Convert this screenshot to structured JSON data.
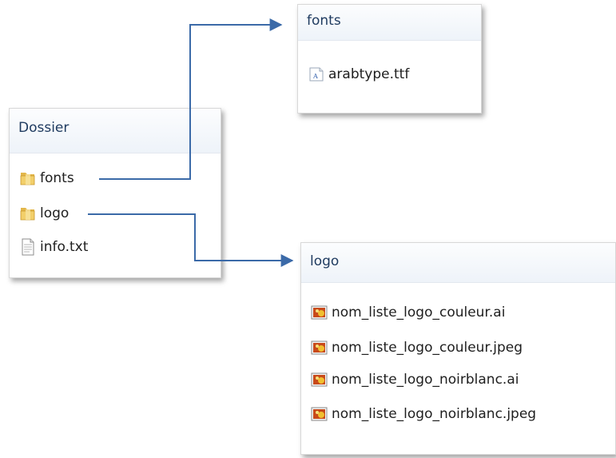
{
  "panels": {
    "dossier": {
      "title": "Dossier",
      "items": [
        {
          "label": "fonts",
          "icon": "folder-icon"
        },
        {
          "label": "logo",
          "icon": "folder-icon"
        },
        {
          "label": "info.txt",
          "icon": "text-file-icon"
        }
      ]
    },
    "fonts": {
      "title": "fonts",
      "items": [
        {
          "label": "arabtype.ttf",
          "icon": "font-file-icon"
        }
      ]
    },
    "logo": {
      "title": "logo",
      "items": [
        {
          "label": "nom_liste_logo_couleur.ai",
          "icon": "image-file-icon"
        },
        {
          "label": "nom_liste_logo_couleur.jpeg",
          "icon": "image-file-icon"
        },
        {
          "label": "nom_liste_logo_noirblanc.ai",
          "icon": "image-file-icon"
        },
        {
          "label": "nom_liste_logo_noirblanc.jpeg",
          "icon": "image-file-icon"
        }
      ]
    }
  },
  "connectors": [
    {
      "from": "dossier.fonts",
      "to": "fonts-panel",
      "color": "#3b6aa8"
    },
    {
      "from": "dossier.logo",
      "to": "logo-panel",
      "color": "#3b6aa8"
    }
  ]
}
